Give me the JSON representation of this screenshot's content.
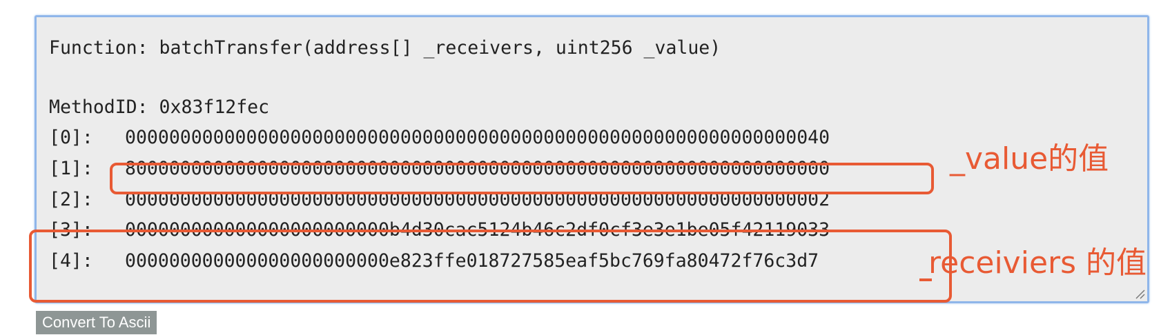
{
  "decoder": {
    "function_line": "Function: batchTransfer(address[] _receivers, uint256 _value)",
    "method_line": "MethodID: 0x83f12fec",
    "params": [
      {
        "index": "[0]:",
        "value": "0000000000000000000000000000000000000000000000000000000000000040"
      },
      {
        "index": "[1]:",
        "value": "8000000000000000000000000000000000000000000000000000000000000000"
      },
      {
        "index": "[2]:",
        "value": "0000000000000000000000000000000000000000000000000000000000000002"
      },
      {
        "index": "[3]:",
        "value": "000000000000000000000000b4d30cac5124b46c2df0cf3e3e1be05f42119033"
      },
      {
        "index": "[4]:",
        "value": "000000000000000000000000e823ffe018727585eaf5bc769fa80472f76c3d7"
      }
    ]
  },
  "annotations": {
    "value_label": "_value的值",
    "receivers_label": "receiviers 的值"
  },
  "colors": {
    "annotation": "#e85a34",
    "textarea_bg": "#ececec",
    "focus_border": "#8fb6ea",
    "button_bg": "#8e9695"
  },
  "button": {
    "convert_label": "Convert To Ascii"
  }
}
